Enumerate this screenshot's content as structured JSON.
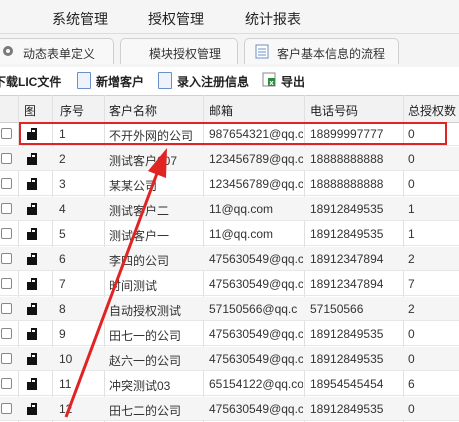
{
  "menu": {
    "items": [
      "系统管理",
      "授权管理",
      "统计报表"
    ]
  },
  "tabs": [
    "动态表单定义",
    "模块授权管理",
    "客户基本信息的流程"
  ],
  "toolbar": {
    "download": "下载LIC文件",
    "add_customer": "新增客户",
    "register": "录入注册信息",
    "export": "导出"
  },
  "table": {
    "headers": [
      "图",
      "序号",
      "客户名称",
      "邮箱",
      "电话号码",
      "总授权数"
    ],
    "rows": [
      [
        "1",
        "不开外网的公司",
        "987654321@qq.c",
        "18899997777",
        "0"
      ],
      [
        "2",
        "测试客户007",
        "123456789@qq.c",
        "18888888888",
        "0"
      ],
      [
        "3",
        "某某公司",
        "123456789@qq.c",
        "18888888888",
        "0"
      ],
      [
        "4",
        "测试客户二",
        "11@qq.com",
        "18912849535",
        "1"
      ],
      [
        "5",
        "测试客户一",
        "11@qq.com",
        "18912849535",
        "1"
      ],
      [
        "6",
        "李四的公司",
        "475630549@qq.c",
        "18912347894",
        "2"
      ],
      [
        "7",
        "时间测试",
        "475630549@qq.c",
        "18912347894",
        "7"
      ],
      [
        "8",
        "自动授权测试",
        "57150566@qq.c",
        "57150566",
        "2"
      ],
      [
        "9",
        "田七一的公司",
        "475630549@qq.c",
        "18912849535",
        "0"
      ],
      [
        "10",
        "赵六一的公司",
        "475630549@qq.c",
        "18912849535",
        "0"
      ],
      [
        "11",
        "冲突测试03",
        "65154122@qq.co",
        "18954545454",
        "6"
      ],
      [
        "12",
        "田七二的公司",
        "475630549@qq.c",
        "18912849535",
        "0"
      ]
    ]
  },
  "colors": {
    "highlight": "#e02424",
    "icon": "#111111",
    "header_bg": "#f2f2f2",
    "alt_row": "#f5f5f5"
  }
}
